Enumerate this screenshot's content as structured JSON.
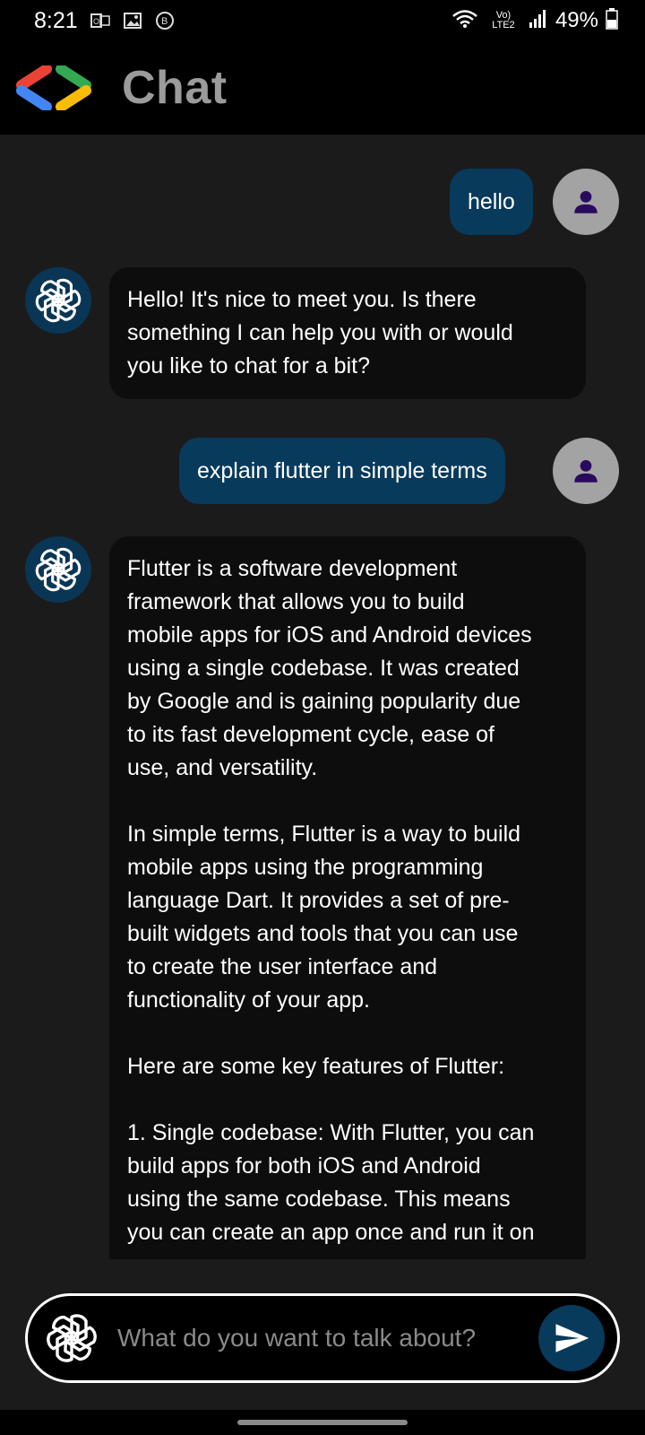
{
  "status_bar": {
    "time": "8:21",
    "left_icons": [
      "outlook-icon",
      "gallery-icon",
      "b-badge-icon"
    ],
    "right_icons": [
      "wifi-icon",
      "volte-lte2-icon",
      "signal-icon"
    ],
    "network_label": "Vo) LTE2",
    "battery_percent": "49%"
  },
  "app_bar": {
    "title": "Chat",
    "logo": "developer-brackets-logo"
  },
  "messages": [
    {
      "role": "user",
      "text": "hello"
    },
    {
      "role": "assistant",
      "text": "Hello! It's nice to meet you. Is there\nsomething I can help you with or would\nyou like to chat for a bit?"
    },
    {
      "role": "user",
      "text": "explain flutter in simple terms"
    },
    {
      "role": "assistant",
      "text": "Flutter is a software development\nframework that allows you to build\nmobile apps for iOS and Android devices\nusing a single codebase. It was created\nby Google and is gaining popularity due\nto its fast development cycle, ease of\nuse, and versatility.\n\nIn simple terms, Flutter is a way to build\nmobile apps using the programming\nlanguage Dart. It provides a set of pre-\nbuilt widgets and tools that you can use\nto create the user interface and\nfunctionality of your app.\n\nHere are some key features of Flutter:\n\n1. Single codebase: With Flutter, you can\nbuild apps for both iOS and Android\nusing the same codebase. This means\nyou can create an app once and run it on"
    }
  ],
  "composer": {
    "placeholder": "What do you want to talk about?",
    "value": ""
  },
  "colors": {
    "user_bubble": "#083a5c",
    "assistant_bubble": "#0d0d0d",
    "user_avatar": "#a3a3a3",
    "assistant_avatar": "#0a3656",
    "person_icon": "#2a0a5e",
    "background": "#1b1b1b"
  }
}
